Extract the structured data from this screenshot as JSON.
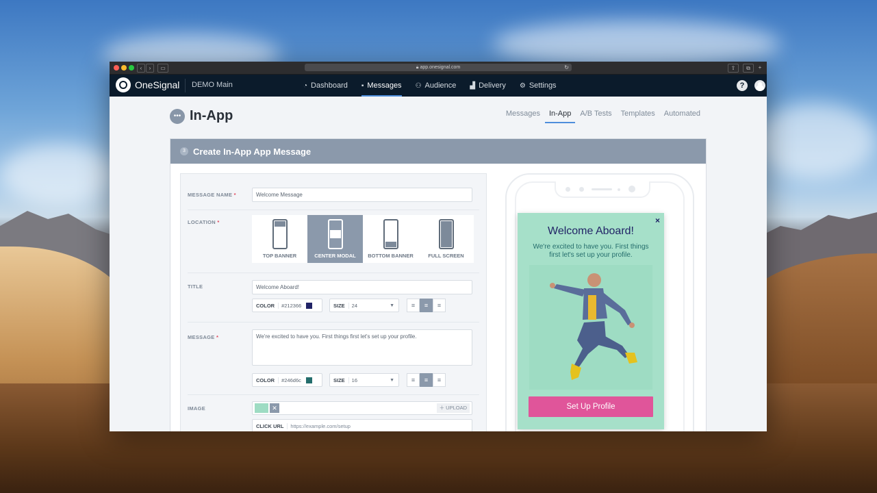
{
  "browser": {
    "url": "app.onesignal.com"
  },
  "nav": {
    "brand": "OneSignal",
    "app_name": "DEMO Main",
    "items": [
      {
        "icon": "gauge-icon",
        "label": "Dashboard"
      },
      {
        "icon": "chat-icon",
        "label": "Messages"
      },
      {
        "icon": "people-icon",
        "label": "Audience"
      },
      {
        "icon": "chart-icon",
        "label": "Delivery"
      },
      {
        "icon": "gear-icon",
        "label": "Settings"
      }
    ],
    "active": "Messages",
    "help": "?"
  },
  "page": {
    "title": "In-App",
    "tabs": [
      "Messages",
      "In-App",
      "A/B Tests",
      "Templates",
      "Automated"
    ],
    "active_tab": "In-App"
  },
  "card": {
    "step": "3",
    "title": "Create In-App App Message"
  },
  "form": {
    "message_name": {
      "label": "MESSAGE NAME",
      "required": "*",
      "value": "Welcome Message"
    },
    "location": {
      "label": "LOCATION",
      "required": "*",
      "options": [
        "TOP BANNER",
        "CENTER MODAL",
        "BOTTOM BANNER",
        "FULL SCREEN"
      ],
      "selected": "CENTER MODAL"
    },
    "title": {
      "label": "TITLE",
      "value": "Welcome Aboard!",
      "color_label": "COLOR",
      "color": "#212366",
      "size_label": "SIZE",
      "size": "24"
    },
    "message": {
      "label": "MESSAGE",
      "required": "*",
      "value": "We're excited to have you. First things first let's set up your profile.",
      "color_label": "COLOR",
      "color": "#246d6c",
      "size_label": "SIZE",
      "size": "16"
    },
    "image": {
      "label": "IMAGE",
      "upload": "UPLOAD",
      "remove": "✕"
    },
    "click_url": {
      "label": "CLICK URL",
      "value": "https://example.com/setup"
    }
  },
  "preview": {
    "title": "Welcome Aboard!",
    "message": "We're excited to have you. First things first let's set up your profile.",
    "button": "Set Up Profile",
    "close": "×",
    "colors": {
      "background": "#a6e0c9",
      "title": "#212366",
      "message": "#246d6c",
      "button": "#e0559a"
    }
  }
}
